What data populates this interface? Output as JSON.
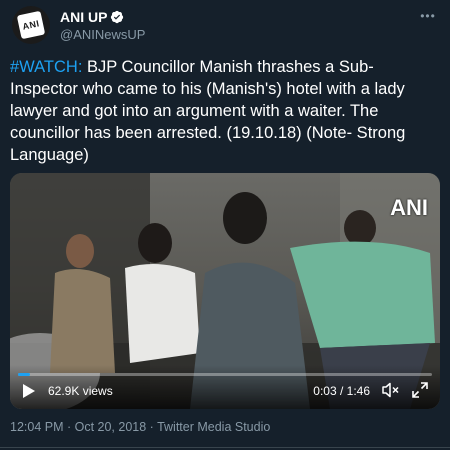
{
  "account": {
    "avatar_text": "ANI",
    "display_name": "ANI UP",
    "handle": "@ANINewsUP",
    "verified_icon": "verified-badge-icon"
  },
  "tweet": {
    "hashtag": "#WATCH:",
    "body": " BJP Councillor Manish thrashes a Sub-Inspector who came to his (Manish's) hotel with a lady lawyer and got into an argument with a waiter. The councillor has been arrested. (19.10.18) (Note- Strong Language)"
  },
  "video": {
    "watermark": "ANI",
    "views": "62.9K views",
    "time": "0:03 / 1:46",
    "progress_fraction": 0.03,
    "icons": {
      "play": "play-icon",
      "mute": "mute-icon",
      "fullscreen": "fullscreen-icon"
    }
  },
  "meta": {
    "timestamp_source": "12:04 PM · Oct 20, 2018 · Twitter Media Studio"
  },
  "colors": {
    "background": "#15202b",
    "accent": "#1da1f2",
    "secondary_text": "#8899a6"
  }
}
